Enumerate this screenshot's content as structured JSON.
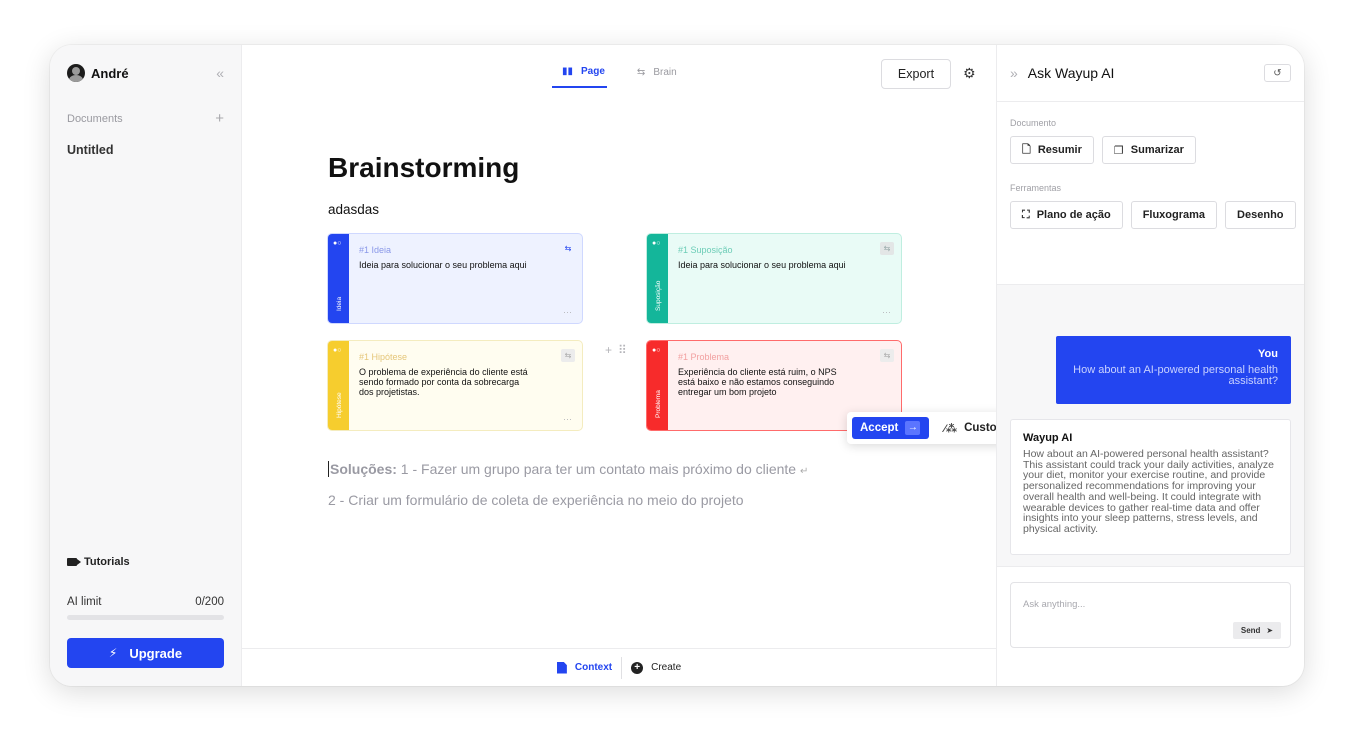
{
  "sidebar": {
    "user_name": "André",
    "documents_label": "Documents",
    "documents": [
      {
        "label": "Untitled"
      }
    ],
    "tutorials_label": "Tutorials",
    "ai_limit_label": "AI limit",
    "ai_limit_value": "0/200",
    "ai_limit_fraction": 0,
    "upgrade_label": "Upgrade"
  },
  "header": {
    "tabs": [
      {
        "label": "Page",
        "active": true
      },
      {
        "label": "Brain",
        "active": false
      }
    ],
    "export_label": "Export"
  },
  "page": {
    "title": "Brainstorming",
    "subtitle": "adasdas"
  },
  "cards": [
    {
      "title": "#1 Ideia",
      "text": "Ideia para solucionar o seu problema aqui",
      "side_label": "Ideia",
      "color": "#2345f0"
    },
    {
      "title": "#1 Suposição",
      "text": "Ideia para solucionar o seu problema aqui",
      "side_label": "Suposição",
      "color": "#14b69a"
    },
    {
      "title": "#1 Hipótese",
      "text": "O problema de experiência do cliente está sendo formado por conta da sobrecarga dos projetistas.",
      "side_label": "Hipótese",
      "color": "#f6cd2e"
    },
    {
      "title": "#1 Problema",
      "text": "Experiência do cliente está ruim, o NPS está baixo e não estamos conseguindo entregar um bom projeto",
      "side_label": "Problema",
      "color": "#f72b2b"
    }
  ],
  "popup": {
    "accept_label": "Accept",
    "customize_label": "Customize"
  },
  "solutions": {
    "label": "Soluções:",
    "line1": " 1 - Fazer um grupo para ter um contato mais próximo do cliente",
    "line2": "2 - Criar um formulário de coleta de experiência no meio do projeto"
  },
  "bottom_bar": {
    "context_label": "Context",
    "create_label": "Create"
  },
  "right_panel": {
    "title": "Ask Wayup AI",
    "documento_label": "Documento",
    "resumir_label": "Resumir",
    "sumarizar_label": "Sumarizar",
    "ferramentas_label": "Ferramentas",
    "plano_label": "Plano de ação",
    "fluxograma_label": "Fluxograma",
    "desenho_label": "Desenho",
    "user_author": "You",
    "user_message": "How about an AI-powered personal health assistant?",
    "ai_author": "Wayup AI",
    "ai_message": "How about an AI-powered personal health assistant? This assistant could track your daily activities, analyze your diet, monitor your exercise routine, and provide personalized recommendations for improving your overall health and well-being. It could integrate with wearable devices to gather real-time data and offer insights into your sleep patterns, stress levels, and physical activity.",
    "input_placeholder": "Ask anything...",
    "send_label": "Send"
  },
  "colors": {
    "accent": "#2345f0"
  }
}
